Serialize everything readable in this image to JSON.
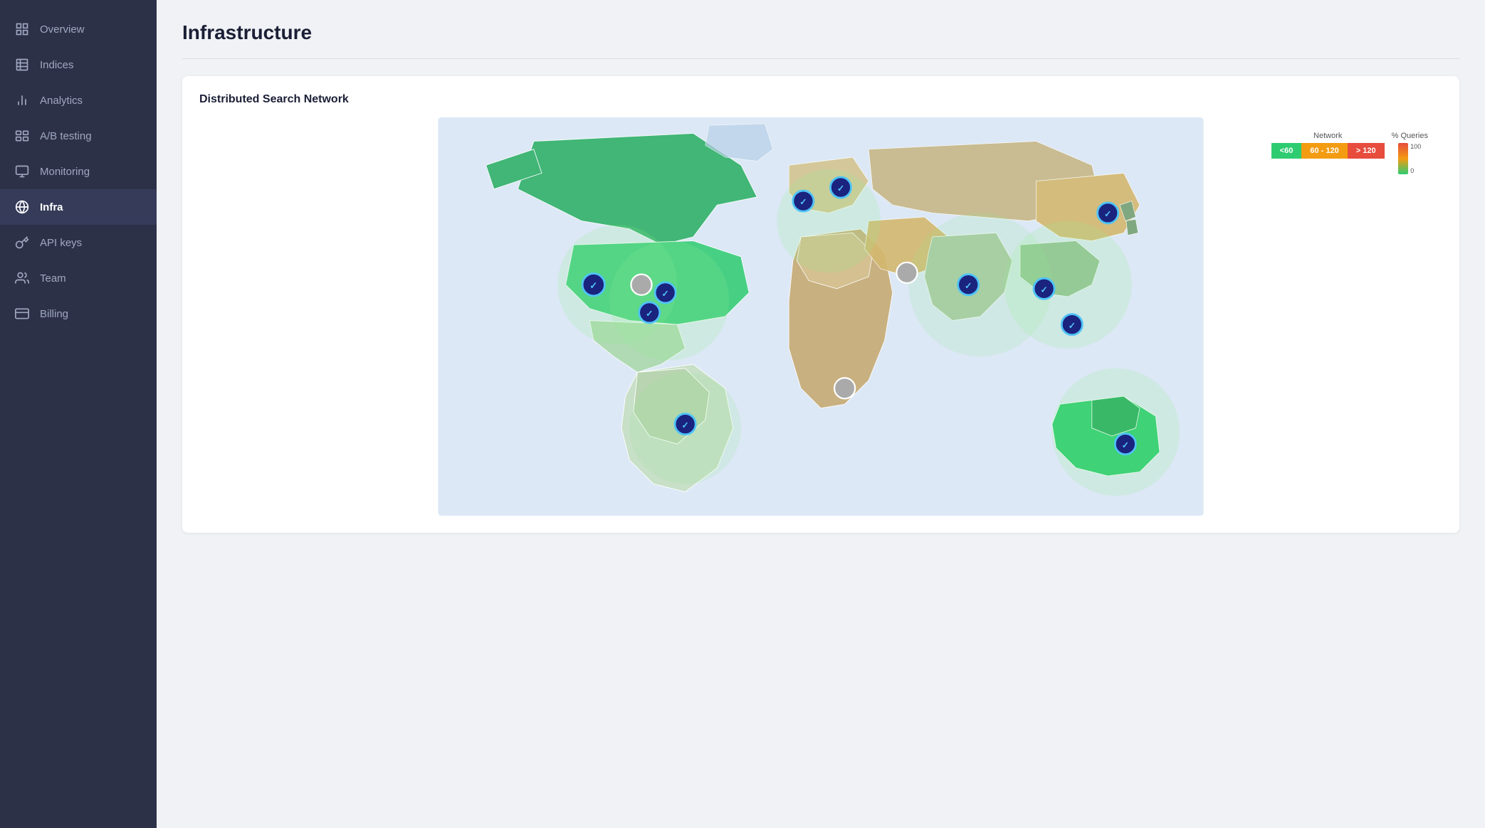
{
  "sidebar": {
    "items": [
      {
        "id": "overview",
        "label": "Overview",
        "icon": "grid"
      },
      {
        "id": "indices",
        "label": "Indices",
        "icon": "table"
      },
      {
        "id": "analytics",
        "label": "Analytics",
        "icon": "bar-chart"
      },
      {
        "id": "ab-testing",
        "label": "A/B testing",
        "icon": "split"
      },
      {
        "id": "monitoring",
        "label": "Monitoring",
        "icon": "monitor"
      },
      {
        "id": "infra",
        "label": "Infra",
        "icon": "globe",
        "active": true
      },
      {
        "id": "api-keys",
        "label": "API keys",
        "icon": "key"
      },
      {
        "id": "team",
        "label": "Team",
        "icon": "users"
      },
      {
        "id": "billing",
        "label": "Billing",
        "icon": "credit-card"
      }
    ]
  },
  "page": {
    "title": "Infrastructure"
  },
  "map_section": {
    "title": "Distributed Search Network",
    "legend": {
      "network_label": "Network",
      "queries_label": "% Queries",
      "segments": [
        {
          "label": "<60",
          "color": "green"
        },
        {
          "label": "60 - 120",
          "color": "orange"
        },
        {
          "label": "> 120",
          "color": "red"
        }
      ],
      "scale_top": "100",
      "scale_bottom": "0"
    }
  }
}
